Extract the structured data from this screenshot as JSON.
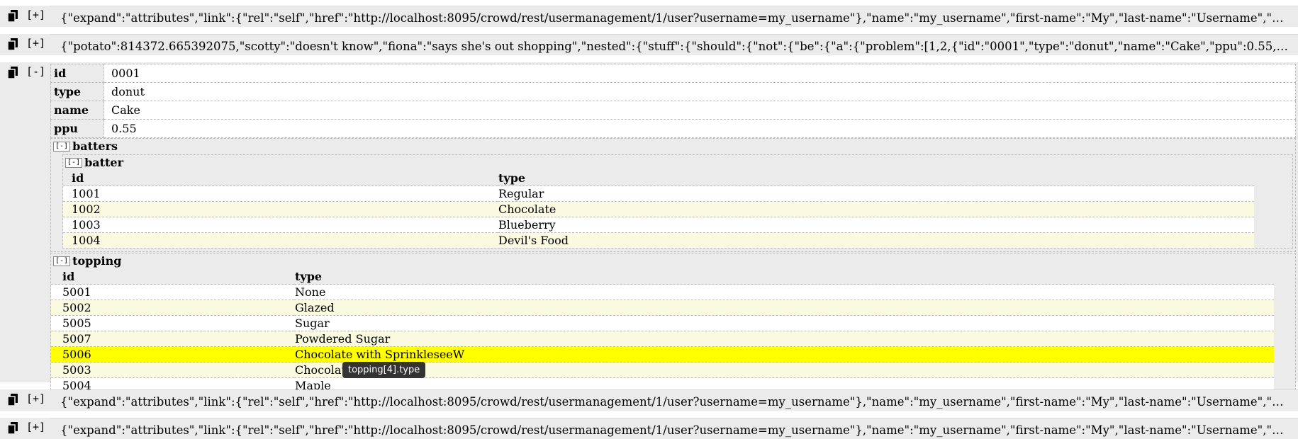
{
  "rows": [
    {
      "toggle": "[+]",
      "json": "{\"expand\":\"attributes\",\"link\":{\"rel\":\"self\",\"href\":\"http://localhost:8095/crowd/rest/usermanagement/1/user?username=my_username\"},\"name\":\"my_username\",\"first-name\":\"My\",\"last-name\":\"Username\",\"display-..."
    },
    {
      "toggle": "[+]",
      "json": "{\"potato\":814372.665392075,\"scotty\":\"doesn't know\",\"fiona\":\"says she's out shopping\",\"nested\":{\"stuff\":{\"should\":{\"not\":{\"be\":{\"a\":{\"problem\":[1,2,{\"id\":\"0001\",\"type\":\"donut\",\"name\":\"Cake\",\"ppu\":0.55,\"batter..."
    },
    {
      "toggle": "[+]",
      "json": "{\"expand\":\"attributes\",\"link\":{\"rel\":\"self\",\"href\":\"http://localhost:8095/crowd/rest/usermanagement/1/user?username=my_username\"},\"name\":\"my_username\",\"first-name\":\"My\",\"last-name\":\"Username\",\"display-..."
    },
    {
      "toggle": "[+]",
      "json": "{\"expand\":\"attributes\",\"link\":{\"rel\":\"self\",\"href\":\"http://localhost:8095/crowd/rest/usermanagement/1/user?username=my_username\"},\"name\":\"my_username\",\"first-name\":\"My\",\"last-name\":\"Username\",\"display-..."
    }
  ],
  "expanded": {
    "toggle": "[-]",
    "fields": [
      {
        "key": "id",
        "value": "0001"
      },
      {
        "key": "type",
        "value": "donut"
      },
      {
        "key": "name",
        "value": "Cake"
      },
      {
        "key": "ppu",
        "value": "0.55"
      }
    ],
    "batters": {
      "label": "batters",
      "toggle": "[-]",
      "batter": {
        "label": "batter",
        "toggle": "[-]",
        "headers": [
          "id",
          "type"
        ],
        "rows": [
          [
            "1001",
            "Regular"
          ],
          [
            "1002",
            "Chocolate"
          ],
          [
            "1003",
            "Blueberry"
          ],
          [
            "1004",
            "Devil's Food"
          ]
        ]
      }
    },
    "topping": {
      "label": "topping",
      "toggle": "[-]",
      "headers": [
        "id",
        "type"
      ],
      "rows": [
        [
          "5001",
          "None"
        ],
        [
          "5002",
          "Glazed"
        ],
        [
          "5005",
          "Sugar"
        ],
        [
          "5007",
          "Powdered Sugar"
        ],
        [
          "5006",
          "Chocolate with SprinkleseeW"
        ],
        [
          "5003",
          "Chocolate"
        ],
        [
          "5004",
          "Maple"
        ]
      ],
      "highlighted_row": 4
    }
  },
  "tooltip": "topping[4].type"
}
